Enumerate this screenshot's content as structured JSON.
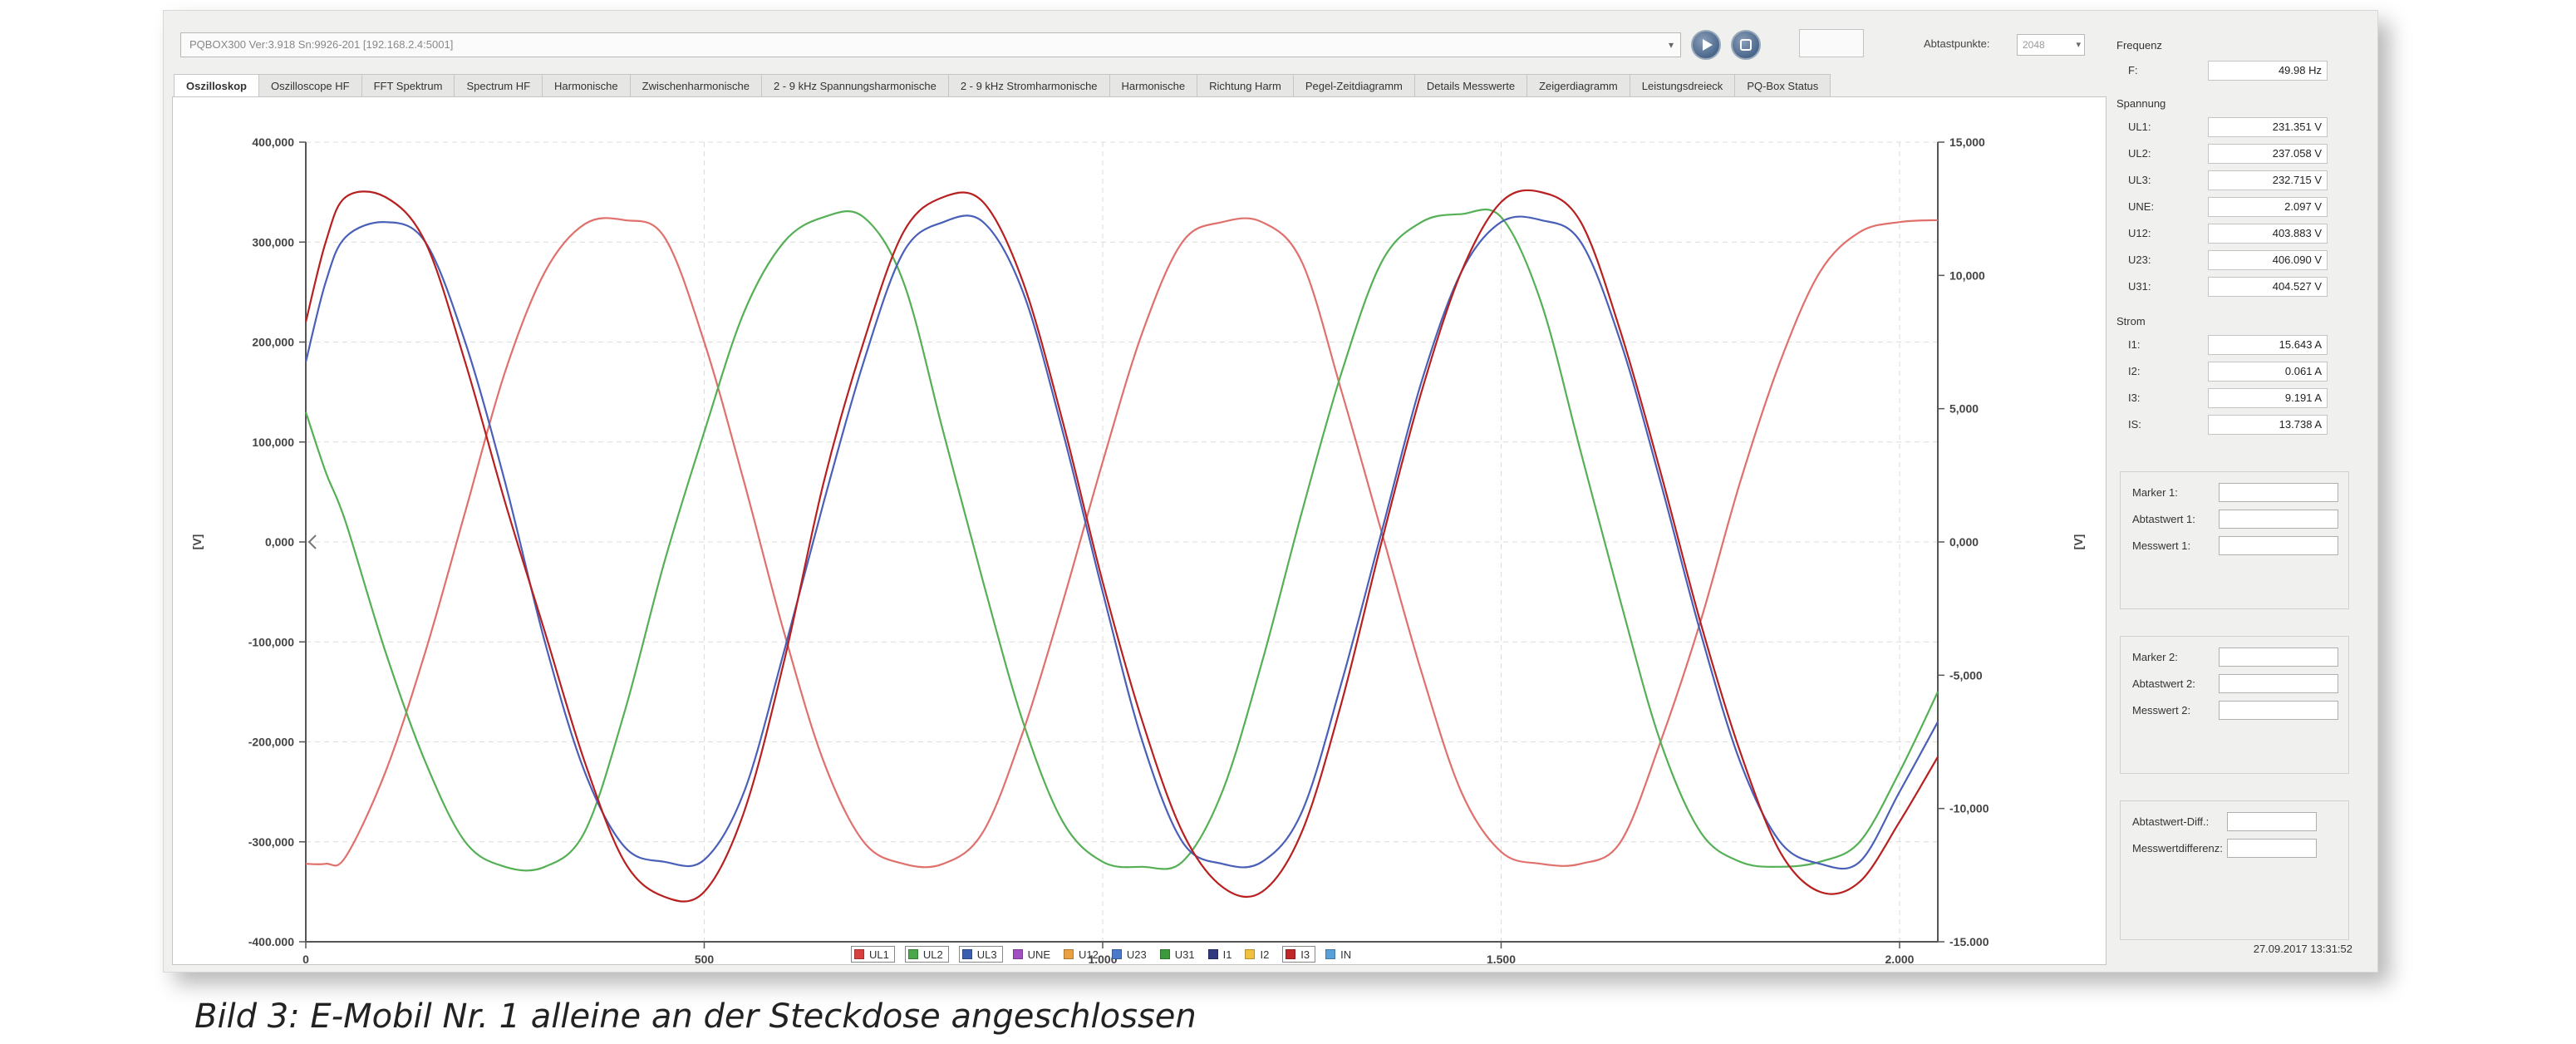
{
  "toolbar": {
    "device": "PQBOX300 Ver:3.918 Sn:9926-201 [192.168.2.4:5001]",
    "sample_points_label": "Abtastpunkte:",
    "sample_points_value": "2048"
  },
  "tabs": [
    {
      "label": "Oszilloskop",
      "active": true
    },
    {
      "label": "Oszilloscope HF"
    },
    {
      "label": "FFT Spektrum"
    },
    {
      "label": "Spectrum HF"
    },
    {
      "label": "Harmonische"
    },
    {
      "label": "Zwischenharmonische"
    },
    {
      "label": "2 - 9 kHz Spannungsharmonische"
    },
    {
      "label": "2 - 9 kHz Stromharmonische"
    },
    {
      "label": "Harmonische"
    },
    {
      "label": "Richtung Harm"
    },
    {
      "label": "Pegel-Zeitdiagramm"
    },
    {
      "label": "Details Messwerte"
    },
    {
      "label": "Zeigerdiagramm"
    },
    {
      "label": "Leistungsdreieck"
    },
    {
      "label": "PQ-Box Status"
    }
  ],
  "side_panel": {
    "frequency": {
      "title": "Frequenz",
      "rows": [
        {
          "label": "F:",
          "value": "49.98 Hz"
        }
      ]
    },
    "voltage": {
      "title": "Spannung",
      "rows": [
        {
          "label": "UL1:",
          "value": "231.351 V"
        },
        {
          "label": "UL2:",
          "value": "237.058 V"
        },
        {
          "label": "UL3:",
          "value": "232.715 V"
        },
        {
          "label": "UNE:",
          "value": "2.097 V"
        },
        {
          "label": "U12:",
          "value": "403.883 V"
        },
        {
          "label": "U23:",
          "value": "406.090 V"
        },
        {
          "label": "U31:",
          "value": "404.527 V"
        }
      ]
    },
    "current": {
      "title": "Strom",
      "rows": [
        {
          "label": "I1:",
          "value": "15.643 A"
        },
        {
          "label": "I2:",
          "value": "0.061 A"
        },
        {
          "label": "I3:",
          "value": "9.191 A"
        },
        {
          "label": "IS:",
          "value": "13.738 A"
        }
      ]
    },
    "marker1": {
      "marker": "Marker 1:",
      "sample": "Abtastwert 1:",
      "measured": "Messwert 1:"
    },
    "marker2": {
      "marker": "Marker 2:",
      "sample": "Abtastwert 2:",
      "measured": "Messwert 2:"
    },
    "diff": {
      "sample_diff": "Abtastwert-Diff.:",
      "measured_diff": "Messwertdifferenz:"
    },
    "timestamp": "27.09.2017 13:31:52"
  },
  "caption": "Bild 3: E-Mobil Nr. 1 alleine an der Steckdose angeschlossen",
  "chart_data": {
    "type": "line",
    "x_range": [
      0,
      2048
    ],
    "x_ticks": [
      0,
      500,
      1000,
      1500,
      2000
    ],
    "x_tick_labels": [
      "0",
      "500",
      "1.000",
      "1.500",
      "2.000"
    ],
    "y_left": {
      "label": "[V]",
      "range": [
        -400000,
        400000
      ],
      "ticks": [
        400000,
        300000,
        200000,
        100000,
        0,
        -100000,
        -200000,
        -300000,
        -400000
      ],
      "tick_labels": [
        "400,000",
        "300,000",
        "200,000",
        "100,000",
        "0,000",
        "-100,000",
        "-200,000",
        "-300,000",
        "-400.000"
      ]
    },
    "y_right": {
      "label": "[V]",
      "range": [
        -15000,
        15000
      ],
      "ticks": [
        15000,
        10000,
        5000,
        0,
        -5000,
        -10000,
        -15000
      ],
      "tick_labels": [
        "15,000",
        "10,000",
        "5,000",
        "0,000",
        "-5,000",
        "-10,000",
        "-15.000"
      ]
    },
    "grid": true,
    "legend_position": "bottom-center",
    "legend": [
      {
        "name": "UL1",
        "color": "#d94040",
        "boxed": true
      },
      {
        "name": "UL2",
        "color": "#4aa84a",
        "boxed": true
      },
      {
        "name": "UL3",
        "color": "#3a5fb0",
        "boxed": true
      },
      {
        "name": "UNE",
        "color": "#a050c0"
      },
      {
        "name": "U12",
        "color": "#e8a040"
      },
      {
        "name": "U23",
        "color": "#4a7ac8"
      },
      {
        "name": "U31",
        "color": "#3c9a3c"
      },
      {
        "name": "I1",
        "color": "#303880"
      },
      {
        "name": "I2",
        "color": "#f0c040"
      },
      {
        "name": "I3",
        "color": "#c02828",
        "boxed": true
      },
      {
        "name": "IN",
        "color": "#5aa0d8"
      }
    ],
    "series": [
      {
        "name": "UL1",
        "color": "#e0706c",
        "axis": "left",
        "x": [
          0,
          25,
          50,
          100,
          150,
          200,
          250,
          300,
          350,
          400,
          450,
          500,
          550,
          600,
          650,
          700,
          750,
          800,
          850,
          900,
          950,
          1000,
          1050,
          1100,
          1150,
          1200,
          1250,
          1300,
          1350,
          1400,
          1450,
          1500,
          1550,
          1600,
          1650,
          1700,
          1750,
          1800,
          1850,
          1900,
          1950,
          2000,
          2048
        ],
        "y": [
          -322000,
          -322000,
          -315000,
          -230000,
          -110000,
          30000,
          170000,
          270000,
          318000,
          322000,
          305000,
          200000,
          60000,
          -90000,
          -220000,
          -300000,
          -322000,
          -322000,
          -290000,
          -190000,
          -60000,
          80000,
          210000,
          300000,
          320000,
          320000,
          280000,
          150000,
          10000,
          -130000,
          -250000,
          -310000,
          -322000,
          -322000,
          -300000,
          -200000,
          -80000,
          60000,
          180000,
          270000,
          310000,
          320000,
          322000
        ]
      },
      {
        "name": "UL2",
        "color": "#55b055",
        "axis": "left",
        "x": [
          0,
          25,
          50,
          100,
          150,
          200,
          250,
          300,
          350,
          400,
          450,
          500,
          550,
          600,
          650,
          700,
          750,
          800,
          850,
          900,
          950,
          1000,
          1050,
          1100,
          1150,
          1200,
          1250,
          1300,
          1350,
          1400,
          1450,
          1500,
          1550,
          1600,
          1650,
          1700,
          1750,
          1800,
          1850,
          1900,
          1950,
          2000,
          2048
        ],
        "y": [
          130000,
          70000,
          20000,
          -110000,
          -220000,
          -300000,
          -325000,
          -325000,
          -290000,
          -170000,
          -20000,
          110000,
          230000,
          300000,
          325000,
          325000,
          260000,
          110000,
          -40000,
          -180000,
          -280000,
          -320000,
          -325000,
          -320000,
          -250000,
          -120000,
          30000,
          170000,
          280000,
          320000,
          328000,
          325000,
          240000,
          90000,
          -60000,
          -200000,
          -290000,
          -320000,
          -325000,
          -320000,
          -300000,
          -230000,
          -150000
        ]
      },
      {
        "name": "UL3",
        "color": "#4a60b8",
        "axis": "left",
        "x": [
          0,
          25,
          50,
          100,
          150,
          200,
          250,
          300,
          350,
          400,
          450,
          500,
          550,
          600,
          650,
          700,
          750,
          800,
          850,
          900,
          950,
          1000,
          1050,
          1100,
          1150,
          1200,
          1250,
          1300,
          1350,
          1400,
          1450,
          1500,
          1550,
          1600,
          1650,
          1700,
          1750,
          1800,
          1850,
          1900,
          1950,
          2000,
          2048
        ],
        "y": [
          180000,
          260000,
          305000,
          320000,
          300000,
          200000,
          60000,
          -100000,
          -230000,
          -305000,
          -320000,
          -318000,
          -250000,
          -110000,
          40000,
          180000,
          290000,
          320000,
          320000,
          250000,
          110000,
          -50000,
          -200000,
          -300000,
          -322000,
          -320000,
          -270000,
          -140000,
          10000,
          160000,
          270000,
          320000,
          322000,
          300000,
          200000,
          60000,
          -90000,
          -220000,
          -300000,
          -322000,
          -320000,
          -250000,
          -180000
        ]
      },
      {
        "name": "I3",
        "color": "#b82020",
        "axis": "left",
        "x": [
          0,
          25,
          50,
          100,
          150,
          200,
          250,
          300,
          350,
          400,
          450,
          500,
          550,
          600,
          650,
          700,
          750,
          800,
          850,
          900,
          950,
          1000,
          1050,
          1100,
          1150,
          1200,
          1250,
          1300,
          1350,
          1400,
          1450,
          1500,
          1550,
          1600,
          1650,
          1700,
          1750,
          1800,
          1850,
          1900,
          1950,
          2000,
          2048
        ],
        "y": [
          220000,
          300000,
          345000,
          345000,
          300000,
          180000,
          40000,
          -90000,
          -220000,
          -320000,
          -355000,
          -350000,
          -270000,
          -120000,
          60000,
          200000,
          310000,
          345000,
          340000,
          260000,
          120000,
          -40000,
          -180000,
          -290000,
          -345000,
          -350000,
          -290000,
          -160000,
          0,
          150000,
          270000,
          340000,
          350000,
          320000,
          210000,
          70000,
          -80000,
          -210000,
          -310000,
          -350000,
          -340000,
          -280000,
          -215000
        ]
      }
    ]
  }
}
